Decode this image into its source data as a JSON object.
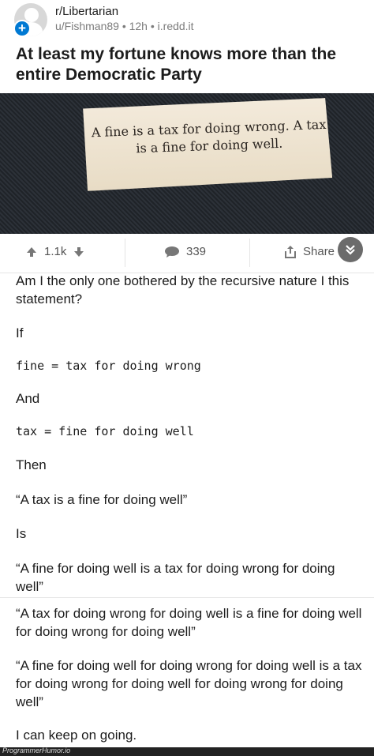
{
  "post": {
    "subreddit": "r/Libertarian",
    "meta": "u/Fishman89 • 12h • i.redd.it",
    "title": "At least my fortune knows more than the entire Democratic Party",
    "image_text": "A fine is a tax for doing wrong. A tax is a fine for doing well."
  },
  "actions": {
    "upvotes": "1.1k",
    "comments": "339",
    "share": "Share"
  },
  "comment": {
    "intro": "Am I the only one bothered by the recursive nature I this statement?",
    "if": "If",
    "code1": "fine = tax for doing wrong",
    "and": "And",
    "code2": "tax = fine for doing well",
    "then": "Then",
    "quote1": "“A tax is a fine for doing well”",
    "is": "Is",
    "quote2": "“A fine for doing well is a tax for doing wrong for doing well”",
    "quote3": "“A tax for doing wrong for doing well is a fine for doing well for doing wrong for doing well”",
    "quote4": "“A fine for doing well for doing wrong for doing well is a tax for doing wrong for doing well for doing wrong for doing well”",
    "closing": "I can keep on going."
  },
  "footer": {
    "watermark": "ProgrammerHumor.io"
  },
  "icons": [
    "subreddit-avatar-icon",
    "join-plus-icon",
    "upvote-arrow-icon",
    "downvote-arrow-icon",
    "comment-bubble-icon",
    "share-icon",
    "scroll-down-icon"
  ]
}
